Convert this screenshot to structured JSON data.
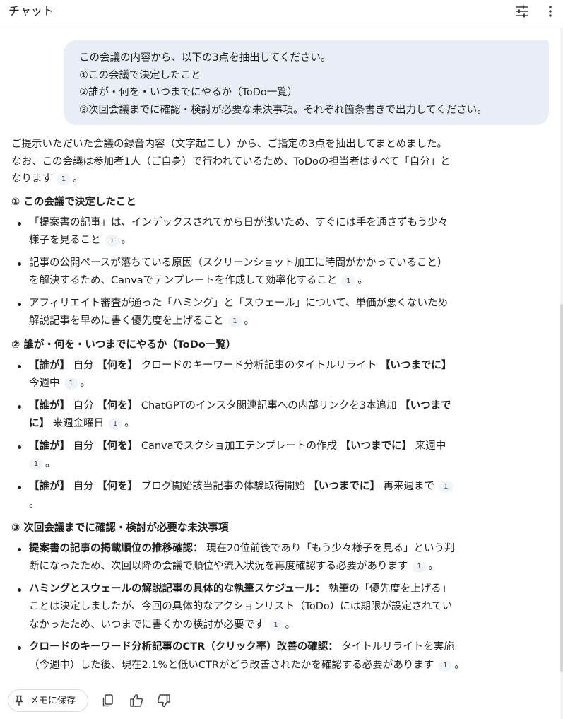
{
  "header": {
    "title": "チャット",
    "tune_icon": "tune-icon",
    "more_icon": "more-vert-icon"
  },
  "user_message": {
    "lines": [
      "この会議の内容から、以下の3点を抽出してください。",
      "①この会議で決定したこと",
      "②誰が・何を・いつまでにやるか（ToDo一覧）",
      "③次回会議までに確認・検討が必要な未決事項。それぞれ箇条書きで出力してください。"
    ]
  },
  "response": {
    "intro_a": "ご提示いただいた会議の録音内容（文字起こし）から、ご指定の3点を抽出してまとめました。",
    "intro_b": "なお、この会議は参加者1人（ご自身）で行われているため、ToDoの担当者はすべて「自分」と",
    "intro_c": "なります",
    "cite": "1",
    "period": "。",
    "section1": {
      "heading": "① この会議で決定したこと",
      "items": [
        {
          "l1": "「提案書の記事」は、インデックスされてから日が浅いため、すぐには手を通さずもう少々",
          "l2": "様子を見ること"
        },
        {
          "l1": "記事の公開ペースが落ちている原因（スクリーンショット加工に時間がかかっていること）",
          "l2": "を解決するため、Canvaでテンプレートを作成して効率化すること"
        },
        {
          "l1": "アフィリエイト審査が通った「ハミング」と「スウェール」について、単価が悪くないため",
          "l2": "解説記事を早めに書く優先度を上げること"
        }
      ]
    },
    "section2": {
      "heading": "② 誰が・何を・いつまでにやるか（ToDo一覧）",
      "who_label": "【誰が】",
      "what_label": "【何を】",
      "when_label": "【いつまでに】",
      "when_label_a": "【いつまで",
      "when_label_b": "に】",
      "who": "自分",
      "items": [
        {
          "what": "クロードのキーワード分析記事のタイトルリライト",
          "when": "今週中"
        },
        {
          "what": "ChatGPTのインスタ関連記事への内部リンクを3本追加",
          "when": "来週金曜日"
        },
        {
          "what": "Canvaでスクショ加工テンプレートの作成",
          "when": "来週中"
        },
        {
          "what": "ブログ開始該当記事の体験取得開始",
          "when": "再来週まで"
        }
      ]
    },
    "section3": {
      "heading": "③ 次回会議までに確認・検討が必要な未決事項",
      "items": [
        {
          "title": "提案書の記事の掲載順位の推移確認：",
          "l1": "現在20位前後であり「もう少々様子を見る」という判",
          "l2": "断になったため、次回以降の会議で順位や流入状況を再度確認する必要があります"
        },
        {
          "title": "ハミングとスウェールの解説記事の具体的な執筆スケジュール：",
          "l1": "執筆の「優先度を上げる」",
          "l2": "ことは決定しましたが、今回の具体的なアクションリスト（ToDo）には期限が設定されてい",
          "l3": "なかったため、いつまでに書くかの検討が必要です"
        },
        {
          "title": "クロードのキーワード分析記事のCTR（クリック率）改善の確認：",
          "l1": "タイトルリライトを実施",
          "l2": "（今週中）した後、現在2.1%と低いCTRがどう改善されたかを確認する必要があります"
        }
      ]
    }
  },
  "actions": {
    "save_label": "メモに保存",
    "pin_icon": "pin-icon",
    "copy_icon": "copy-icon",
    "like_icon": "thumb-up-icon",
    "dislike_icon": "thumb-down-icon"
  }
}
